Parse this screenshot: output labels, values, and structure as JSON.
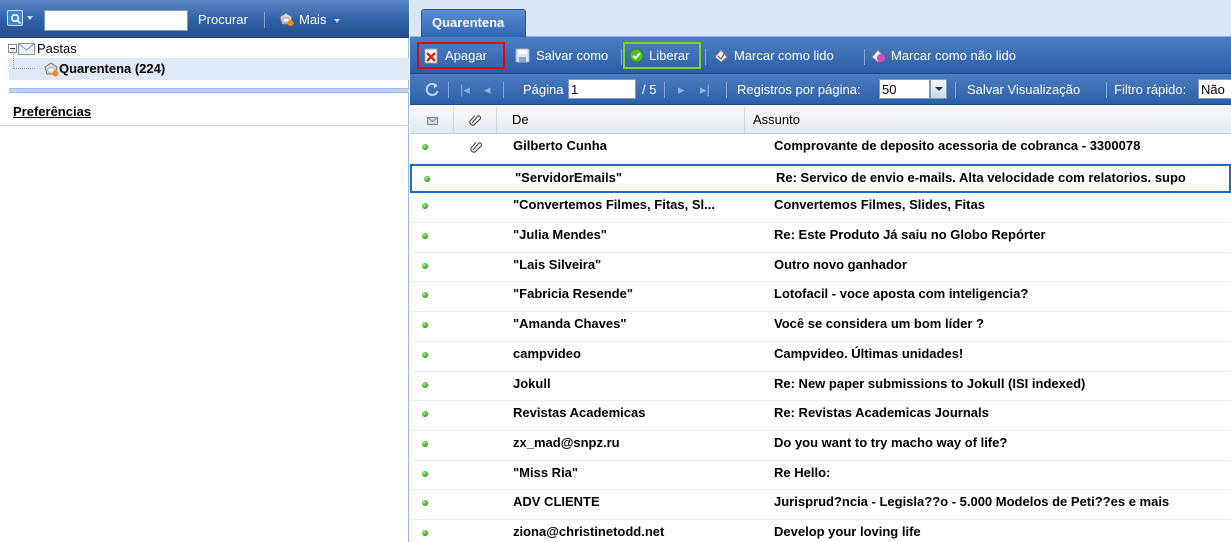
{
  "left": {
    "search": {
      "value": "",
      "procurar_label": "Procurar",
      "mais_label": "Mais"
    },
    "tree": {
      "root_label": "Pastas",
      "quarentena_label": "Quarentena (224)"
    },
    "preferences_label": "Preferências"
  },
  "right": {
    "tab_label": "Quarentena",
    "toolbar": {
      "apagar": "Apagar",
      "salvar_como": "Salvar como",
      "liberar": "Liberar",
      "marcar_lido": "Marcar como lido",
      "marcar_nao_lido": "Marcar como não lido"
    },
    "pager": {
      "pagina_label": "Página",
      "page_value": "1",
      "total_pages": "/ 5",
      "registros_label": "Registros por página:",
      "per_page_value": "50",
      "salvar_visualizacao": "Salvar Visualização",
      "filtro_label": "Filtro rápido:",
      "filtro_value": "Não"
    },
    "columns": {
      "de": "De",
      "assunto": "Assunto"
    },
    "rows": [
      {
        "from": "Gilberto Cunha",
        "subject": "Comprovante de deposito acessoria de cobranca - 3300078",
        "attachment": true
      },
      {
        "from": "\"ServidorEmails\"",
        "subject": "Re: Servico de envio e-mails. Alta velocidade com relatorios. supo",
        "attachment": false,
        "selected": true
      },
      {
        "from": "\"Convertemos Filmes, Fitas, Sl...",
        "subject": "Convertemos Filmes, Slides, Fitas",
        "attachment": false
      },
      {
        "from": "\"Julia Mendes\"",
        "subject": "Re: Este Produto Já saiu no Globo Repórter",
        "attachment": false
      },
      {
        "from": "\"Lais Silveira\"",
        "subject": "Outro novo ganhador",
        "attachment": false
      },
      {
        "from": "\"Fabricia Resende\"",
        "subject": "Lotofacil - voce aposta com inteligencia?",
        "attachment": false
      },
      {
        "from": "\"Amanda Chaves\"",
        "subject": "Você se considera um bom líder ?",
        "attachment": false
      },
      {
        "from": "campvideo",
        "subject": "Campvideo. Últimas unidades!",
        "attachment": false
      },
      {
        "from": "Jokull",
        "subject": "Re: New paper submissions to Jokull (ISI indexed)",
        "attachment": false
      },
      {
        "from": "Revistas Academicas",
        "subject": "Re: Revistas Academicas Journals",
        "attachment": false
      },
      {
        "from": "zx_mad@snpz.ru",
        "subject": "Do you want to try macho way of life?",
        "attachment": false
      },
      {
        "from": "\"Miss Ria\"",
        "subject": "Re Hello:",
        "attachment": false
      },
      {
        "from": "ADV CLIENTE",
        "subject": "Jurisprud?ncia - Legisla??o - 5.000 Modelos de Peti??es e mais",
        "attachment": false
      },
      {
        "from": "ziona@christinetodd.net",
        "subject": "Develop your loving life",
        "attachment": false
      }
    ]
  },
  "colors": {
    "toolbar_blue": "#2c5ea6",
    "apagar_highlight": "#e00a0a",
    "liberar_highlight": "#7ed321",
    "selection_border": "#2468c4"
  }
}
